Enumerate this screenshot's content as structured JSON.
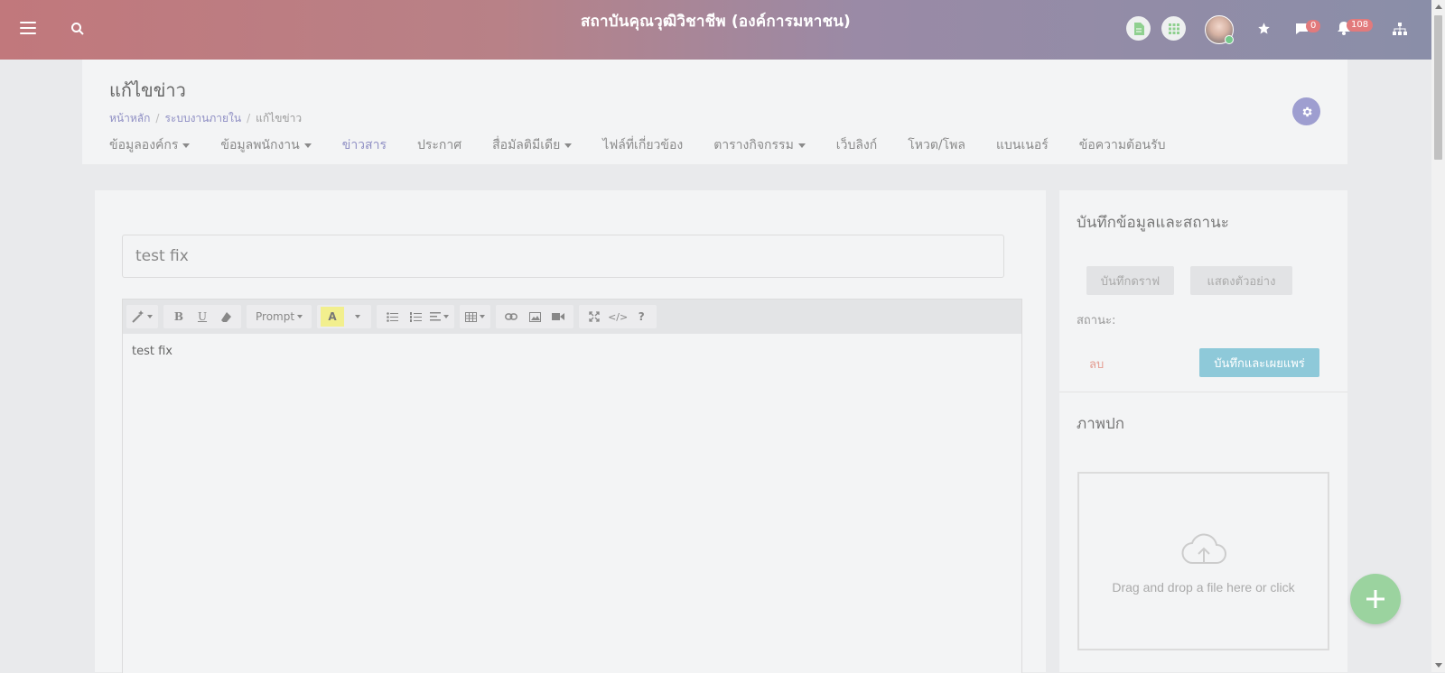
{
  "header": {
    "title": "สถาบันคุณวุฒิวิชาชีพ (องค์การมหาชน)",
    "messages_count": "0",
    "notifications_count": "108",
    "icons": [
      "menu-icon",
      "search-icon",
      "document-icon",
      "grid-icon",
      "avatar",
      "star-icon",
      "chat-icon",
      "bell-icon",
      "sitemap-icon"
    ]
  },
  "page": {
    "title": "แก้ไขข่าว",
    "breadcrumb": [
      "หน้าหลัก",
      "ระบบงานภายใน",
      "แก้ไขข่าว"
    ],
    "tabs": [
      {
        "label": "ข้อมูลองค์กร",
        "dropdown": true
      },
      {
        "label": "ข้อมูลพนักงาน",
        "dropdown": true
      },
      {
        "label": "ข่าวสาร",
        "active": true
      },
      {
        "label": "ประกาศ"
      },
      {
        "label": "สื่อมัลติมีเดีย",
        "dropdown": true
      },
      {
        "label": "ไฟล์ที่เกี่ยวข้อง"
      },
      {
        "label": "ตารางกิจกรรม",
        "dropdown": true
      },
      {
        "label": "เว็บลิงก์"
      },
      {
        "label": "โหวต/โพล"
      },
      {
        "label": "แบนเนอร์"
      },
      {
        "label": "ข้อความต้อนรับ"
      }
    ]
  },
  "editor": {
    "title_value": "test fix",
    "font_name": "Prompt",
    "body_text": "test fix"
  },
  "sidebar": {
    "save_status_title": "บันทึกข้อมูลและสถานะ",
    "save_draft_label": "บันทึกดราฟ",
    "preview_label": "แสดงตัวอย่าง",
    "status_label": "สถานะ:",
    "delete_label": "ลบ",
    "publish_label": "บันทึกและเผยแพร่",
    "cover_title": "ภาพปก",
    "dropzone_text": "Drag and drop a file here or click"
  },
  "colors": {
    "accent": "#8f8fc4",
    "publish": "#8ec9d9",
    "fab": "#9bd39f",
    "badge": "#e27a7c"
  }
}
